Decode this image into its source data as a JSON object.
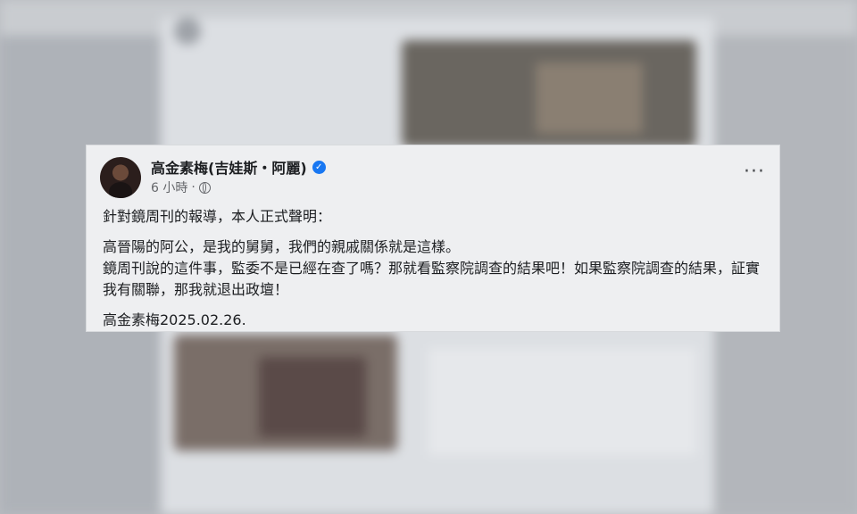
{
  "post": {
    "author": "高金素梅(吉娃斯・阿麗)",
    "time": "6 小時",
    "separator": "·",
    "more": "···",
    "line1": "針對鏡周刊的報導，本人正式聲明：",
    "line2": "高晉陽的阿公，是我的舅舅，我們的親戚關係就是這樣。",
    "line3": "鏡周刊說的這件事，監委不是已經在查了嗎？那就看監察院調查的結果吧！如果監察院調查的結果，証實我有關聯，那我就退出政壇！",
    "line4": "高金素梅2025.02.26.",
    "verified_icon": "verified-check-icon",
    "privacy_icon": "globe-icon"
  },
  "colors": {
    "verified": "#1877f2",
    "card_bg": "#eeeff1",
    "text": "#1c1e21",
    "meta": "#65676b"
  }
}
